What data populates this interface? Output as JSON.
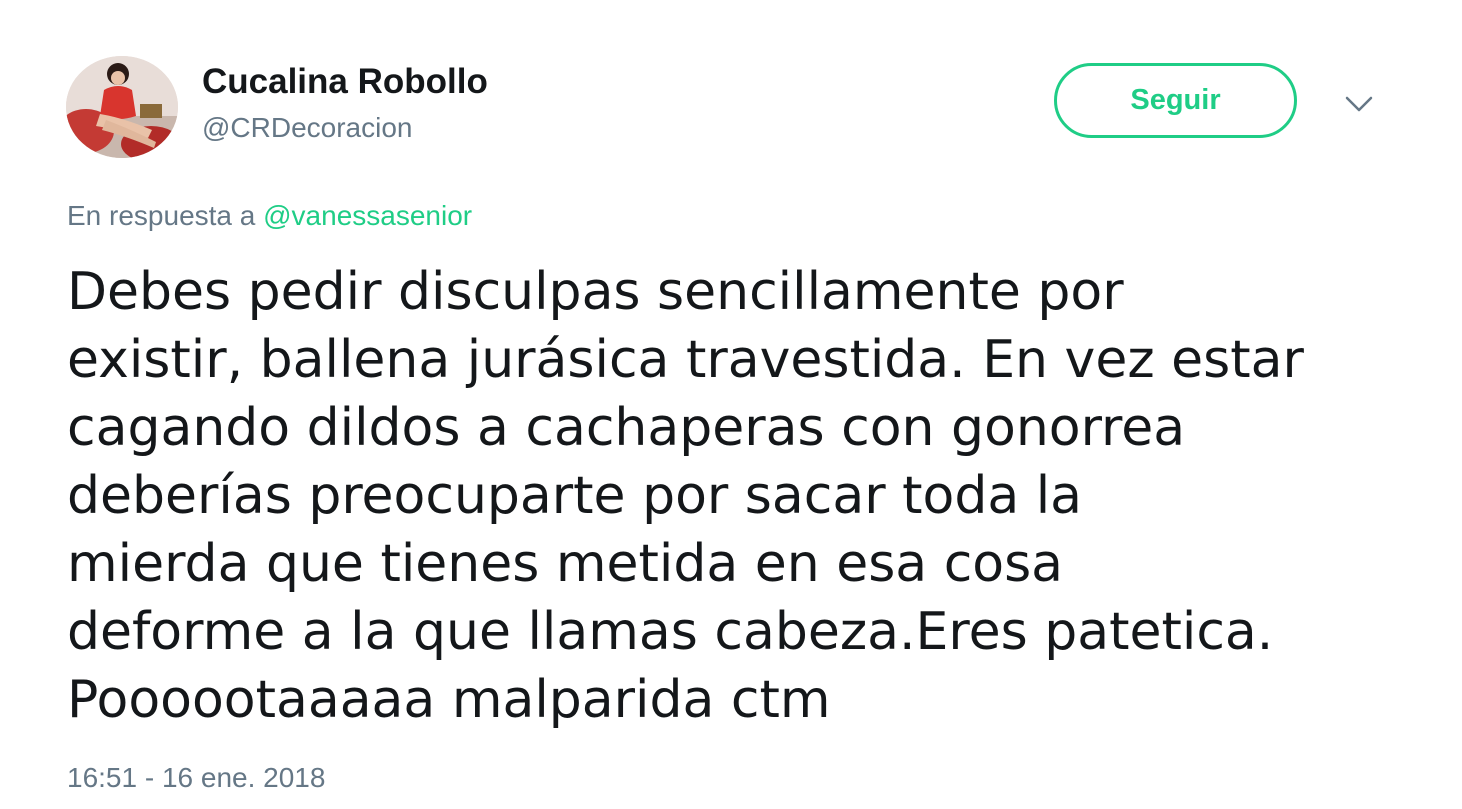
{
  "user": {
    "display_name": "Cucalina Robollo",
    "username": "@CRDecoracion",
    "avatar_icon": "profile-photo"
  },
  "follow_button": {
    "label": "Seguir",
    "color": "#1fcd86"
  },
  "menu": {
    "icon": "chevron-down-icon"
  },
  "reply": {
    "prefix": "En respuesta a",
    "mention": "@vanessasenior"
  },
  "tweet": {
    "lines": [
      "Debes pedir disculpas sencillamente por",
      "existir, ballena jurásica travestida. En vez estar",
      "cagando dildos a cachaperas con gonorrea",
      "deberías preocuparte por sacar toda la",
      "mierda que tienes metida en esa cosa",
      "deforme a la que llamas cabeza.Eres patetica.",
      "Poooootaaaaa malparida ctm"
    ]
  },
  "timestamp": "16:51 - 16 ene. 2018"
}
